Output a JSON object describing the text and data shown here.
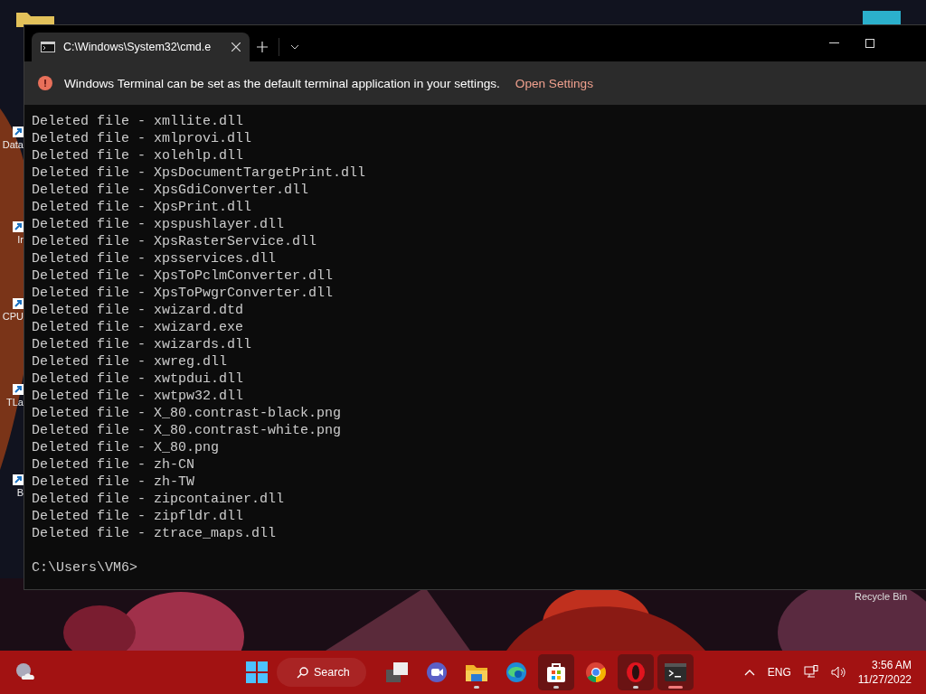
{
  "desktop": {
    "icons": [
      {
        "kind": "shortcut",
        "label": "Data"
      },
      {
        "kind": "shortcut",
        "label": "Ir"
      },
      {
        "kind": "shortcut",
        "label": "CPU"
      },
      {
        "kind": "shortcut",
        "label": "TLa"
      },
      {
        "kind": "shortcut",
        "label": "B"
      }
    ],
    "recycle_bin": {
      "label": "Recycle Bin"
    }
  },
  "window": {
    "tabs": [
      {
        "title": "C:\\Windows\\System32\\cmd.e",
        "selected": true
      }
    ],
    "infobar": {
      "message": "Windows Terminal can be set as the default terminal application in your settings.",
      "link": "Open Settings"
    },
    "terminal": {
      "lines": [
        "Deleted file - xmllite.dll",
        "Deleted file - xmlprovi.dll",
        "Deleted file - xolehlp.dll",
        "Deleted file - XpsDocumentTargetPrint.dll",
        "Deleted file - XpsGdiConverter.dll",
        "Deleted file - XpsPrint.dll",
        "Deleted file - xpspushlayer.dll",
        "Deleted file - XpsRasterService.dll",
        "Deleted file - xpsservices.dll",
        "Deleted file - XpsToPclmConverter.dll",
        "Deleted file - XpsToPwgrConverter.dll",
        "Deleted file - xwizard.dtd",
        "Deleted file - xwizard.exe",
        "Deleted file - xwizards.dll",
        "Deleted file - xwreg.dll",
        "Deleted file - xwtpdui.dll",
        "Deleted file - xwtpw32.dll",
        "Deleted file - X_80.contrast-black.png",
        "Deleted file - X_80.contrast-white.png",
        "Deleted file - X_80.png",
        "Deleted file - zh-CN",
        "Deleted file - zh-TW",
        "Deleted file - zipcontainer.dll",
        "Deleted file - zipfldr.dll",
        "Deleted file - ztrace_maps.dll"
      ],
      "prompt": "C:\\Users\\VM6>"
    }
  },
  "taskbar": {
    "search": "Search",
    "apps": [
      {
        "kind": "taskview",
        "running": false,
        "active": false,
        "highlighted": false
      },
      {
        "kind": "meet",
        "running": false,
        "active": false,
        "highlighted": false
      },
      {
        "kind": "explorer",
        "running": true,
        "active": false,
        "highlighted": false
      },
      {
        "kind": "edge",
        "running": false,
        "active": false,
        "highlighted": false
      },
      {
        "kind": "store",
        "running": true,
        "active": false,
        "highlighted": true
      },
      {
        "kind": "chrome",
        "running": false,
        "active": false,
        "highlighted": false
      },
      {
        "kind": "opera",
        "running": true,
        "active": false,
        "highlighted": true
      },
      {
        "kind": "terminal",
        "running": true,
        "active": true,
        "highlighted": true
      }
    ],
    "language": "ENG",
    "time": "3:56 AM",
    "date": "11/27/2022"
  }
}
